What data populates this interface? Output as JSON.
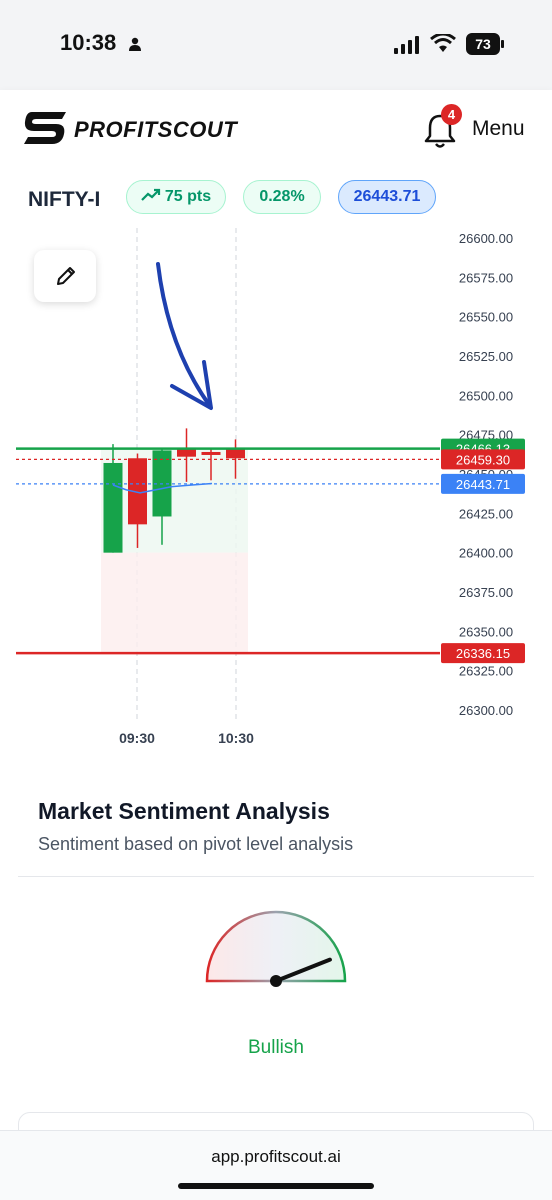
{
  "status_bar": {
    "time": "10:38",
    "battery": "73"
  },
  "header": {
    "logo_text": "PROFITSCOUT",
    "notification_count": "4",
    "menu_label": "Menu"
  },
  "ticker": {
    "symbol": "NIFTY-I",
    "change_pts": "75 pts",
    "change_pct": "0.28%",
    "price": "26443.71"
  },
  "chart_data": {
    "type": "candlestick",
    "y_ticks": [
      "26600.00",
      "26575.00",
      "26550.00",
      "26525.00",
      "26500.00",
      "26475.00",
      "26450.00",
      "26425.00",
      "26400.00",
      "26375.00",
      "26350.00",
      "26325.00",
      "26300.00"
    ],
    "x_ticks": [
      "09:30",
      "10:30"
    ],
    "ylim": [
      26300,
      26600
    ],
    "candles": [
      {
        "open": 26400,
        "high": 26469,
        "low": 26400,
        "close": 26457,
        "direction": "up"
      },
      {
        "open": 26460,
        "high": 26463,
        "low": 26403,
        "close": 26418,
        "direction": "down"
      },
      {
        "open": 26423,
        "high": 26466,
        "low": 26405,
        "close": 26465,
        "direction": "up"
      },
      {
        "open": 26466,
        "high": 26479,
        "low": 26445,
        "close": 26461,
        "direction": "down"
      },
      {
        "open": 26464,
        "high": 26466,
        "low": 26446,
        "close": 26464,
        "direction": "down"
      },
      {
        "open": 26466,
        "high": 26472,
        "low": 26447,
        "close": 26460,
        "direction": "down"
      }
    ],
    "levels": [
      {
        "value": 26466.13,
        "label": "26466.13",
        "color": "#16a34a",
        "style": "solid"
      },
      {
        "value": 26459.3,
        "label": "26459.30",
        "color": "#dc2626",
        "style": "dashed"
      },
      {
        "value": 26443.71,
        "label": "26443.71",
        "color": "#3b82f6",
        "style": "dashed"
      },
      {
        "value": 26336.15,
        "label": "26336.15",
        "color": "#dc2626",
        "style": "solid"
      }
    ]
  },
  "sentiment": {
    "title": "Market Sentiment Analysis",
    "subtitle": "Sentiment based on pivot level analysis",
    "label": "Bullish",
    "needle_value": 0.88
  },
  "browser": {
    "url": "app.profitscout.ai"
  },
  "colors": {
    "up": "#16a34a",
    "down": "#dc2626",
    "accent": "#1e40af"
  }
}
